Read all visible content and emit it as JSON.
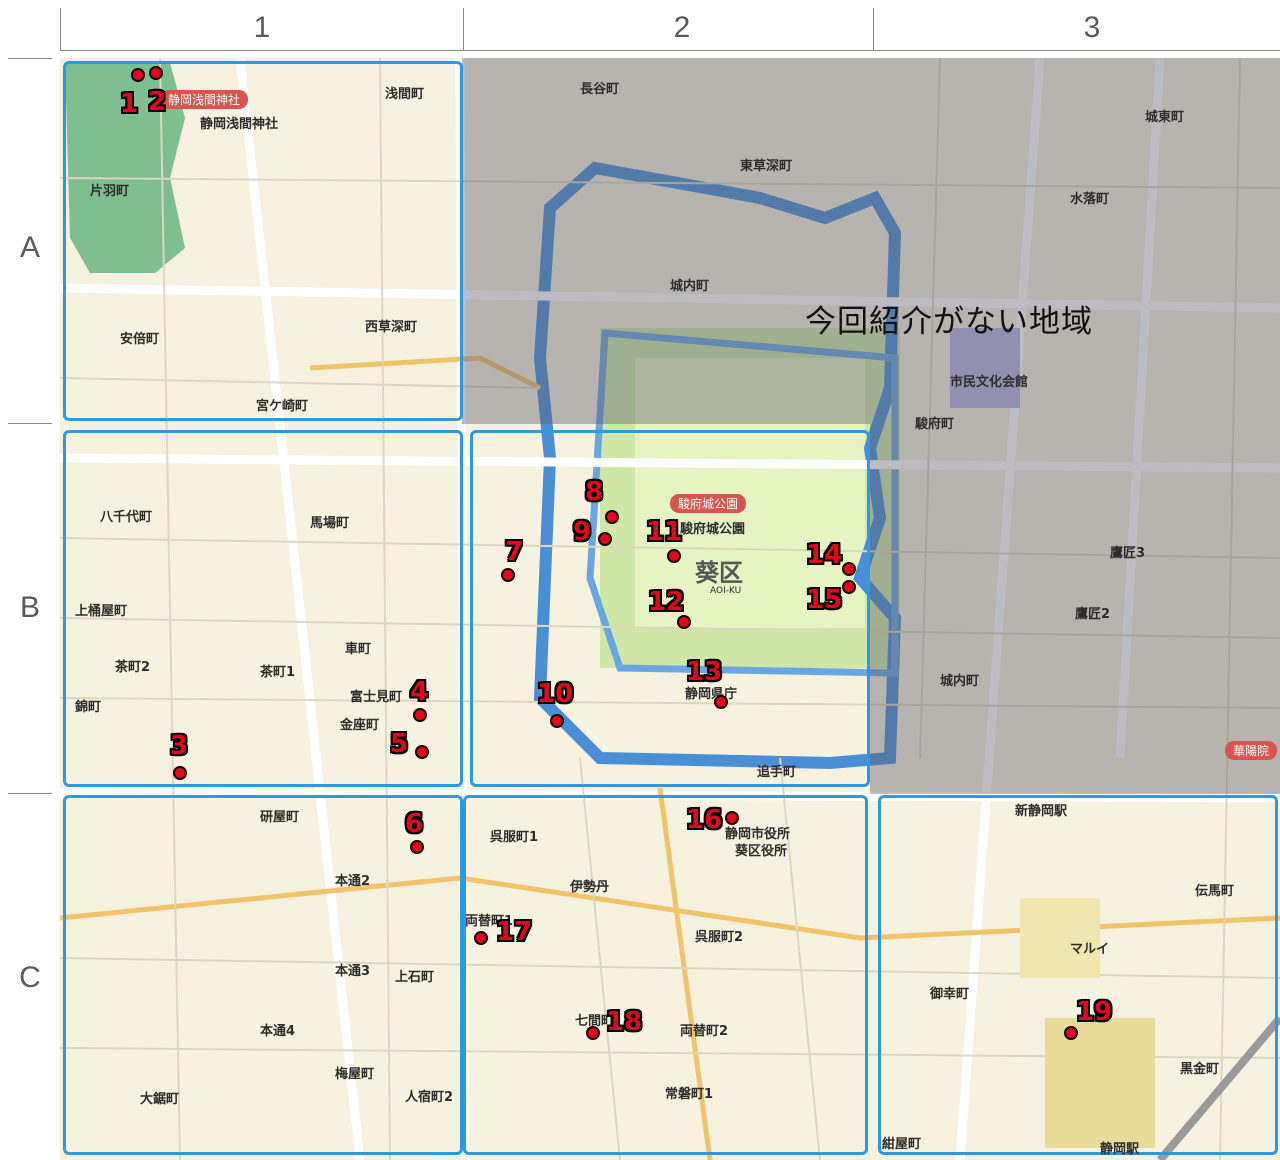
{
  "columns": [
    "1",
    "2",
    "3"
  ],
  "rows": [
    "A",
    "B",
    "C"
  ],
  "no_intro_label": "今回紹介がない地域",
  "markers": [
    "1",
    "2",
    "3",
    "4",
    "5",
    "6",
    "7",
    "8",
    "9",
    "10",
    "11",
    "12",
    "13",
    "14",
    "15",
    "16",
    "17",
    "18",
    "19"
  ],
  "places": {
    "katabacho": "片羽町",
    "anzaicho": "安倍町",
    "asamacho": "浅間町",
    "nishikusabukacho": "西草深町",
    "miyagasakicho": "宮ケ崎町",
    "yachiyocho": "八千代町",
    "babacho": "馬場町",
    "kamiokecho": "上桶屋町",
    "chamachi2": "茶町2",
    "chamachi1": "茶町1",
    "nishikicho": "錦町",
    "kurumamachi": "車町",
    "fujimicho": "富士見町",
    "kinzacho": "金座町",
    "togiyacho": "研屋町",
    "hondori2": "本通2",
    "hondori3": "本通3",
    "hondori4": "本通4",
    "ogiyamachi": "大鋸町",
    "umeyacho": "梅屋町",
    "jokucho": "上石町",
    "nakajukucho2": "人宿町2",
    "gofukucho1": "呉服町1",
    "gofukucho2": "呉服町2",
    "ryogaecho1": "両替町1",
    "ryogaecho2": "両替町2",
    "shichikencho": "七間町",
    "tokiwacho1": "常磐町1",
    "shizuokaekimae": "静岡駅",
    "gokochomachi": "御幸町",
    "koyamachi": "紺屋町",
    "kurokanecho": "黒金町",
    "dembacho": "伝馬町",
    "otemachi": "追手町",
    "takajo3": "鷹匠3",
    "takajo2": "鷹匠2",
    "sunpucho": "駿府町",
    "jonaicho": "城内町",
    "higashikusabukacho": "東草深町",
    "mizuochicho": "水落町",
    "jotocho": "城東町",
    "nagayacho": "長谷町",
    "shimin_bunka_kaikan": "市民文化会館",
    "shin_shizuoka_eki": "新静岡駅",
    "marui": "マルイ",
    "isetan": "伊勢丹"
  },
  "badges": {
    "asama_jinja": "静岡浅間神社",
    "sunpu_park": "駿府城公園",
    "kayoin": "華陽院"
  },
  "ward": {
    "name": "葵区",
    "sub": "AOI-KU"
  },
  "landmarks": {
    "kencho": "静岡県庁",
    "shiyakusho": "静岡市役所",
    "aoi_kuyakusho": "葵区役所",
    "sunpu_koen": "駿府城公園",
    "asama_shrine_label": "静岡浅間神社"
  }
}
